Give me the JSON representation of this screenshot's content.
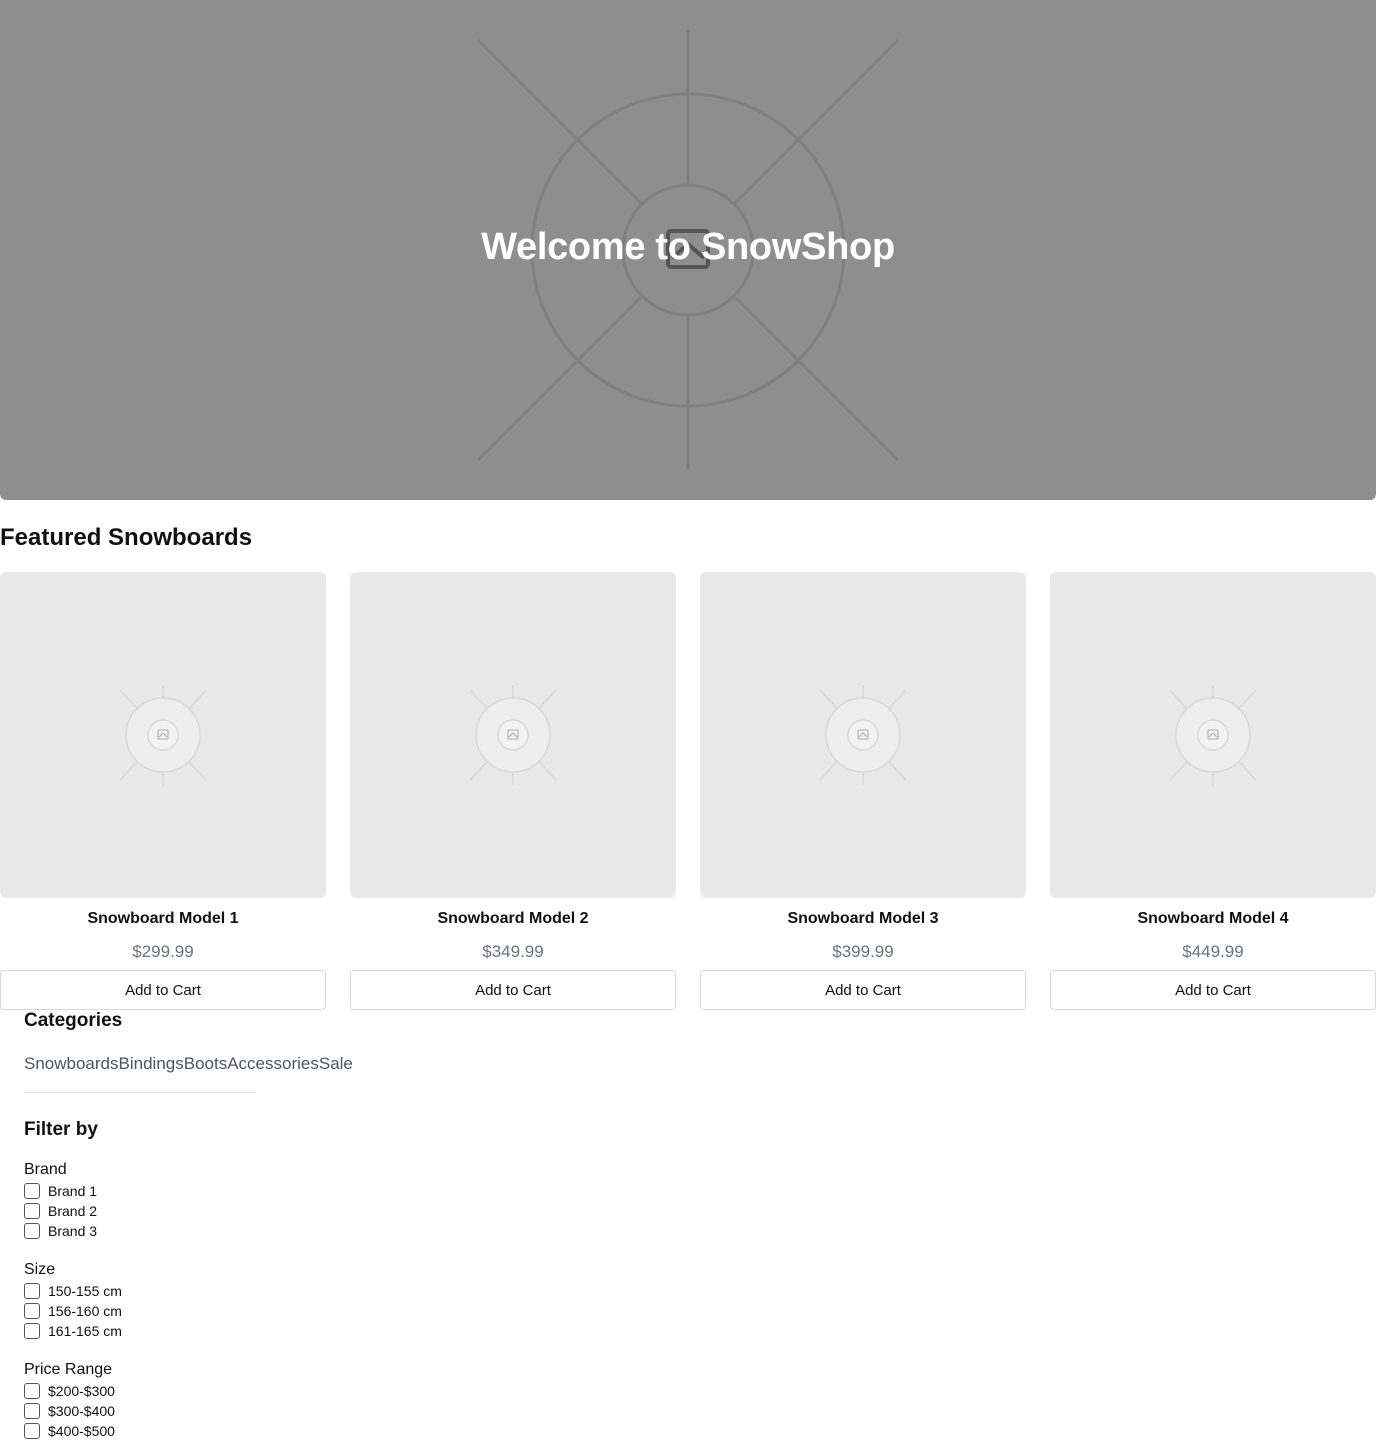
{
  "hero": {
    "title": "Welcome to SnowShop",
    "image_icon": "image-placeholder-icon"
  },
  "featured": {
    "title": "Featured Snowboards",
    "products": [
      {
        "name": "Snowboard Model 1",
        "price": "$299.99",
        "button": "Add to Cart"
      },
      {
        "name": "Snowboard Model 2",
        "price": "$349.99",
        "button": "Add to Cart"
      },
      {
        "name": "Snowboard Model 3",
        "price": "$399.99",
        "button": "Add to Cart"
      },
      {
        "name": "Snowboard Model 4",
        "price": "$449.99",
        "button": "Add to Cart"
      }
    ]
  },
  "sidebar": {
    "categories_title": "Categories",
    "categories": [
      "Snowboards",
      "Bindings",
      "Boots",
      "Accessories",
      "Sale"
    ],
    "filter_title": "Filter by",
    "filters": [
      {
        "label": "Brand",
        "options": [
          "Brand 1",
          "Brand 2",
          "Brand 3"
        ]
      },
      {
        "label": "Size",
        "options": [
          "150-155 cm",
          "156-160 cm",
          "161-165 cm"
        ]
      },
      {
        "label": "Price Range",
        "options": [
          "$200-$300",
          "$300-$400",
          "$400-$500"
        ]
      }
    ]
  },
  "colors": {
    "hero_bg": "#8e8e8e",
    "card_bg": "#e9e9e9",
    "price_text": "#6b7280",
    "category_text": "#4b5563"
  }
}
